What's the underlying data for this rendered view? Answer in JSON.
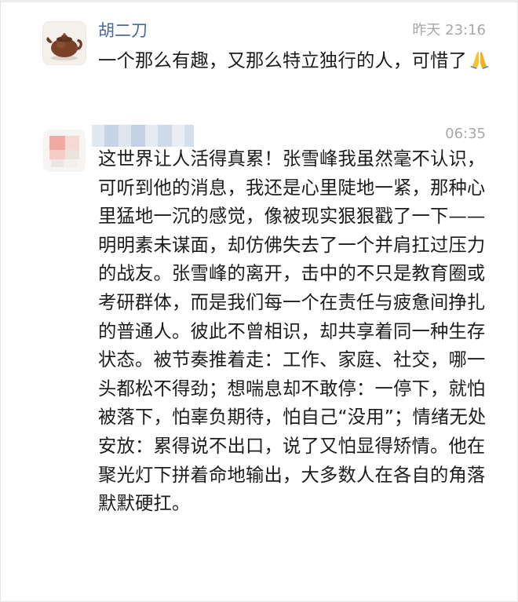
{
  "comments": [
    {
      "author": "胡二刀",
      "time": "昨天 23:16",
      "text": "一个那么有趣，又那么特立独行的人，可惜了",
      "avatar_icon": "teapot-avatar",
      "emoji_icon": "folded-hands-icon"
    },
    {
      "author": "",
      "time": "06:35",
      "text": "这世界让人活得真累！张雪峰我虽然毫不认识，可听到他的消息，我还是心里陡地一紧，那种心里猛地一沉的感觉，像被现实狠狠戳了一下——明明素未谋面，却仿佛失去了一个并肩扛过压力的战友。张雪峰的离开，击中的不只是教育圈或考研群体，而是我们每一个在责任与疲惫间挣扎的普通人。彼此不曾相识，却共享着同一种生存状态。被节奏推着走：工作、家庭、社交，哪一头都松不得劲；想喘息却不敢停：一停下，就怕被落下，怕辜负期待，怕自己“没用”；情绪无处安放：累得说不出口，说了又怕显得矫情。他在聚光灯下拼着命地输出，大多数人在各自的角落默默硬扛。",
      "avatar_icon": "blurred-avatar"
    }
  ],
  "colors": {
    "author_name": "#4a6a9c",
    "timestamp": "#a8a8a8",
    "body_text": "#1c1c1c"
  }
}
